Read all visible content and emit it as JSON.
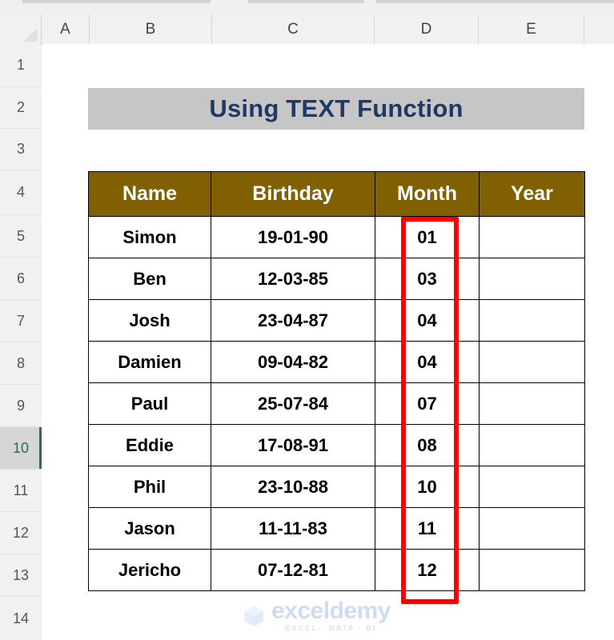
{
  "app": {
    "type": "spreadsheet",
    "column_headers": [
      "A",
      "B",
      "C",
      "D",
      "E"
    ],
    "row_headers": [
      "1",
      "2",
      "3",
      "4",
      "5",
      "6",
      "7",
      "8",
      "9",
      "10",
      "11",
      "12",
      "13",
      "14"
    ],
    "active_row": "10"
  },
  "title_banner": {
    "text": "Using TEXT Function",
    "background_color": "#c6c6c6",
    "text_color": "#1f3864"
  },
  "table": {
    "header_background": "#806000",
    "header_text_color": "#ffffff",
    "columns": [
      "Name",
      "Birthday",
      "Month",
      "Year"
    ],
    "rows": [
      {
        "name": "Simon",
        "birthday": "19-01-90",
        "month": "01",
        "year": ""
      },
      {
        "name": "Ben",
        "birthday": "12-03-85",
        "month": "03",
        "year": ""
      },
      {
        "name": "Josh",
        "birthday": "23-04-87",
        "month": "04",
        "year": ""
      },
      {
        "name": "Damien",
        "birthday": "09-04-82",
        "month": "04",
        "year": ""
      },
      {
        "name": "Paul",
        "birthday": "25-07-84",
        "month": "07",
        "year": ""
      },
      {
        "name": "Eddie",
        "birthday": "17-08-91",
        "month": "08",
        "year": ""
      },
      {
        "name": "Phil",
        "birthday": "23-10-88",
        "month": "10",
        "year": ""
      },
      {
        "name": "Jason",
        "birthday": "11-11-83",
        "month": "11",
        "year": ""
      },
      {
        "name": "Jericho",
        "birthday": "07-12-81",
        "month": "12",
        "year": ""
      }
    ]
  },
  "annotation": {
    "type": "rectangle-highlight",
    "target_column": "Month",
    "color": "#ff0000"
  },
  "watermark": {
    "name": "exceldemy",
    "tagline": "EXCEL · DATA · BI",
    "color": "#5b8dd9"
  }
}
